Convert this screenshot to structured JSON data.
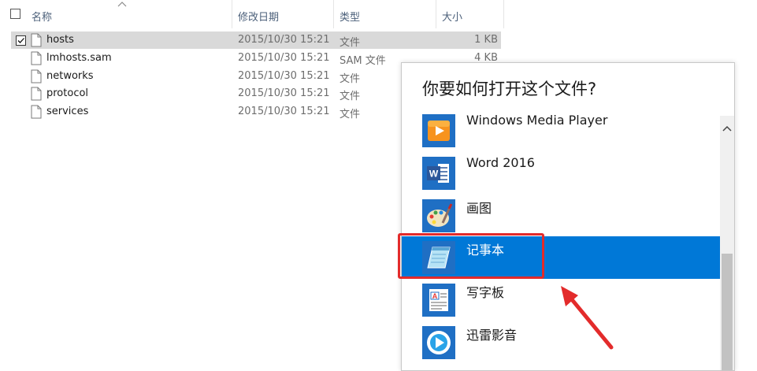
{
  "explorer": {
    "columns": {
      "name": "名称",
      "date": "修改日期",
      "type": "类型",
      "size": "大小"
    },
    "files": [
      {
        "name": "hosts",
        "date": "2015/10/30 15:21",
        "type": "文件",
        "size": "1 KB",
        "selected": true
      },
      {
        "name": "lmhosts.sam",
        "date": "2015/10/30 15:21",
        "type": "SAM 文件",
        "size": "4 KB",
        "selected": false
      },
      {
        "name": "networks",
        "date": "2015/10/30 15:21",
        "type": "文件",
        "size": "",
        "selected": false
      },
      {
        "name": "protocol",
        "date": "2015/10/30 15:21",
        "type": "文件",
        "size": "",
        "selected": false
      },
      {
        "name": "services",
        "date": "2015/10/30 15:21",
        "type": "文件",
        "size": "",
        "selected": false
      }
    ]
  },
  "dialog": {
    "title": "你要如何打开这个文件?",
    "apps": [
      {
        "name": "Windows Media Player",
        "icon": "windows-media-player-icon"
      },
      {
        "name": "Word 2016",
        "icon": "word-icon"
      },
      {
        "name": "画图",
        "icon": "paint-icon"
      },
      {
        "name": "记事本",
        "icon": "notepad-icon",
        "highlighted": true
      },
      {
        "name": "写字板",
        "icon": "wordpad-icon"
      },
      {
        "name": "迅雷影音",
        "icon": "xunlei-player-icon"
      }
    ]
  },
  "colors": {
    "selection": "#d9d9d9",
    "highlight": "#0078d7",
    "annotation": "#e32b2b"
  }
}
